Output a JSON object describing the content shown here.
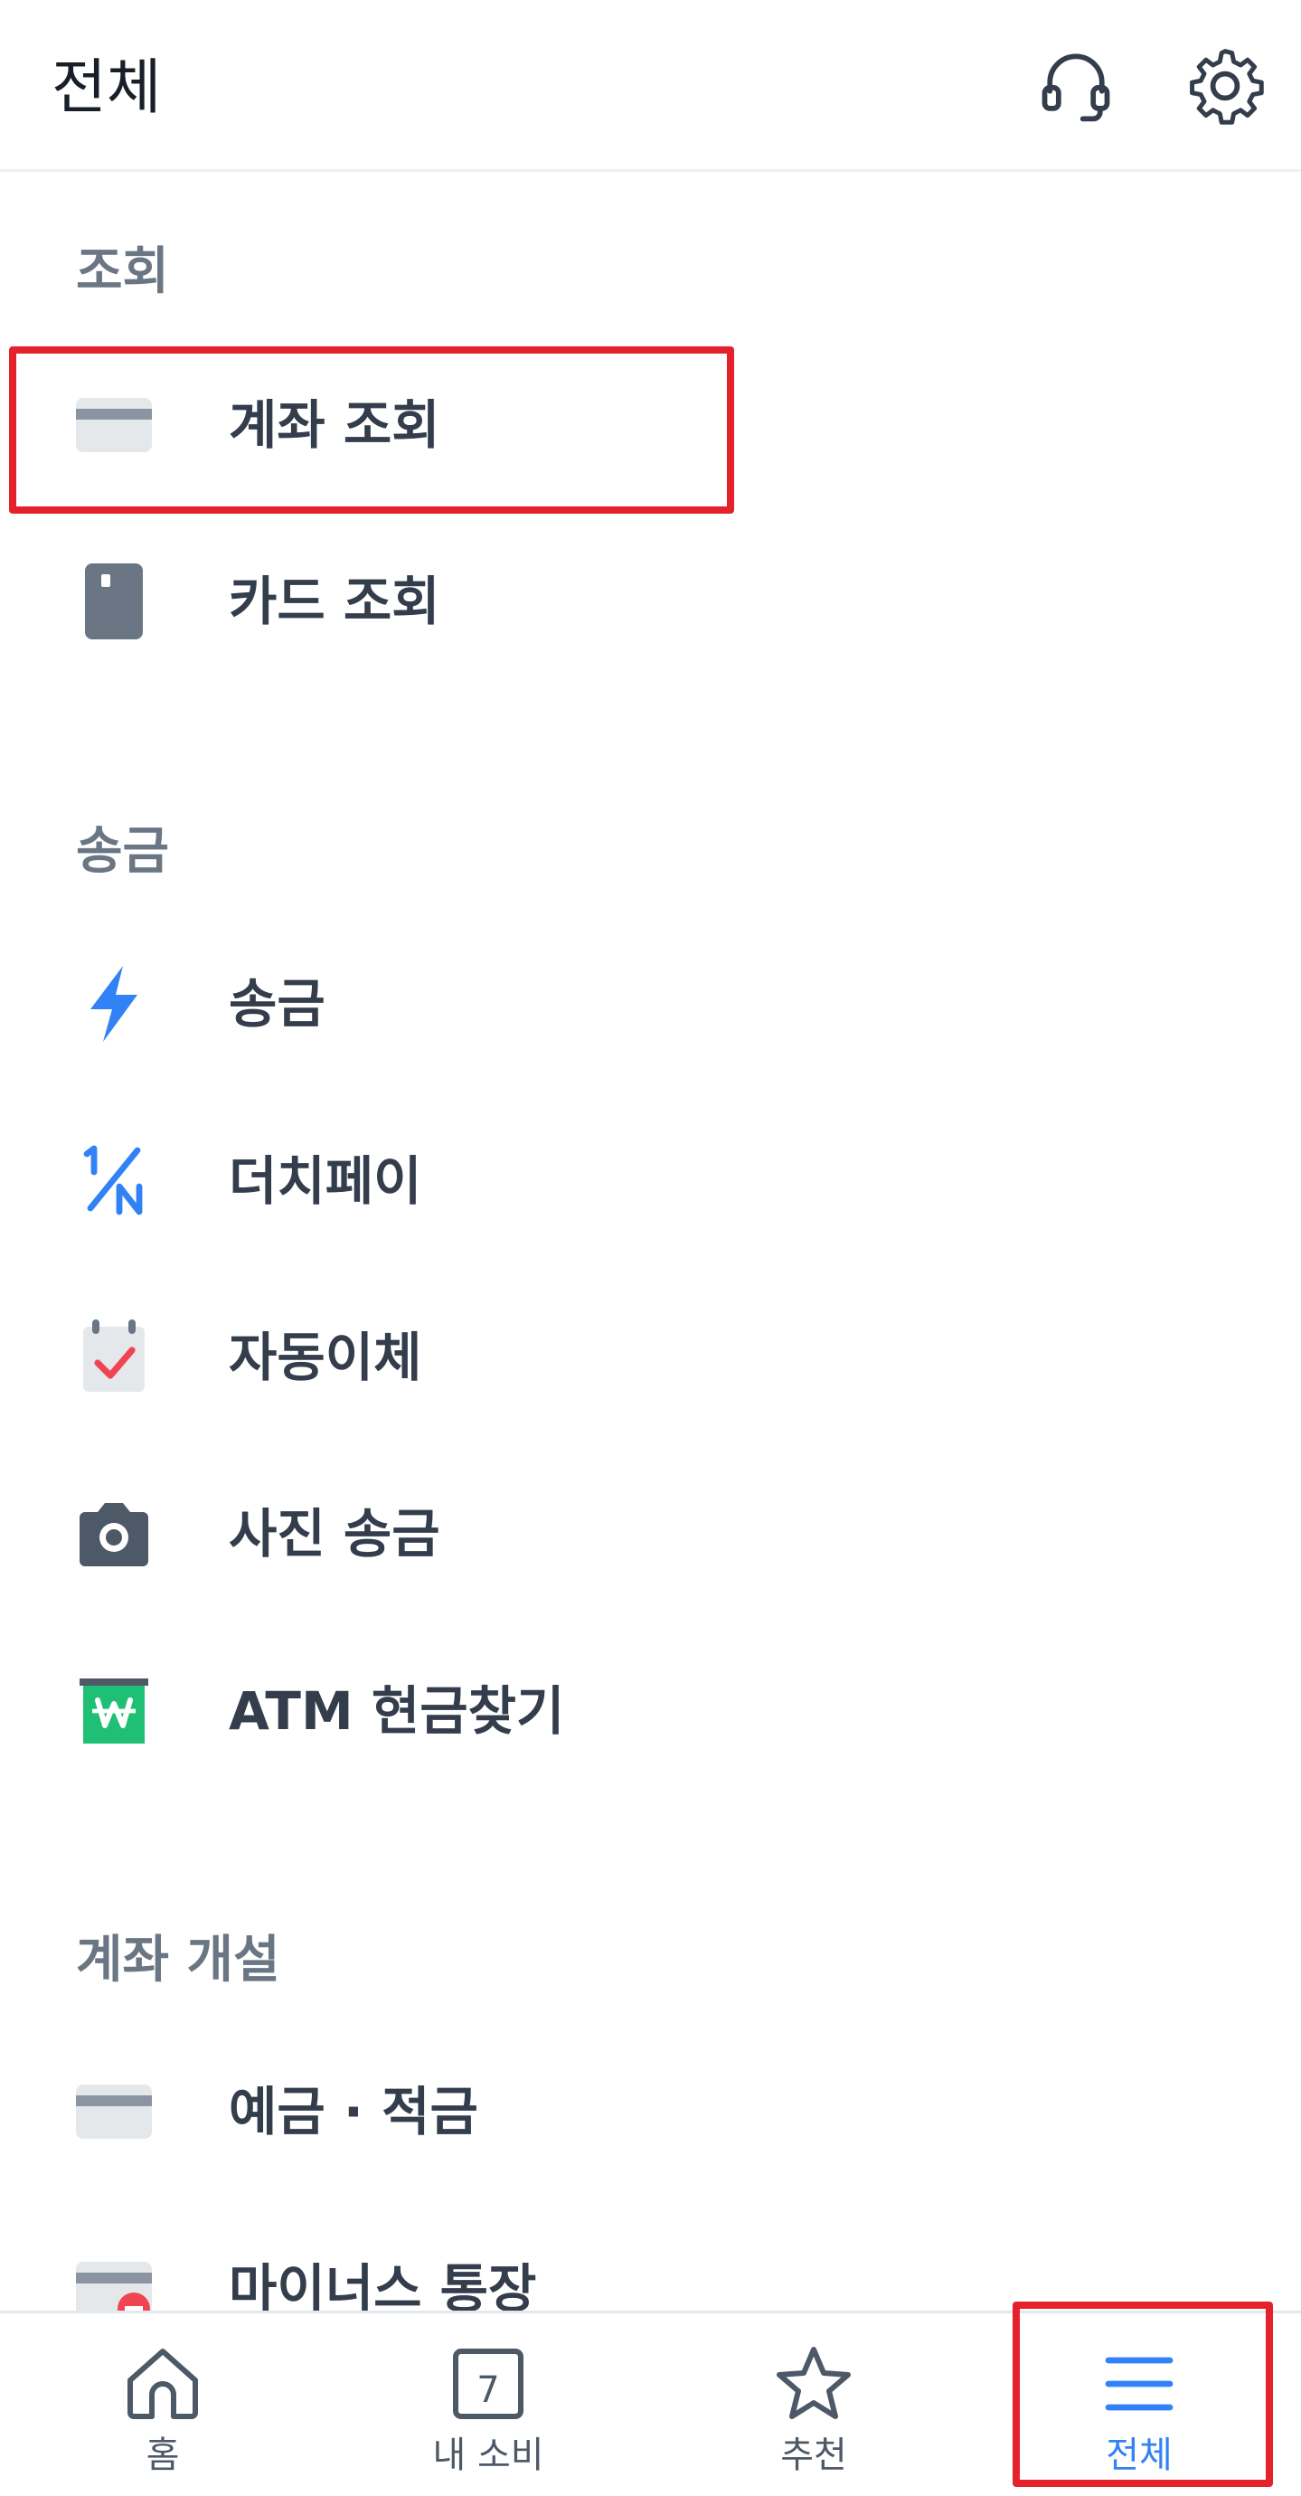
{
  "header": {
    "title": "전체",
    "support_icon": "headset-icon",
    "settings_icon": "gear-icon"
  },
  "sections": [
    {
      "title": "조회",
      "items": [
        {
          "label": "계좌 조회",
          "icon": "account-card-icon"
        },
        {
          "label": "카드 조회",
          "icon": "card-icon"
        }
      ]
    },
    {
      "title": "송금",
      "items": [
        {
          "label": "송금",
          "icon": "lightning-icon"
        },
        {
          "label": "더치페이",
          "icon": "one-over-n-icon"
        },
        {
          "label": "자동이체",
          "icon": "calendar-check-icon"
        },
        {
          "label": "사진 송금",
          "icon": "camera-icon"
        },
        {
          "label": "ATM 현금찾기",
          "icon": "atm-won-icon"
        }
      ]
    },
    {
      "title": "계좌 개설",
      "items": [
        {
          "label": "예금 · 적금",
          "icon": "savings-card-icon"
        },
        {
          "label": "마이너스 통장",
          "icon": "minus-account-icon"
        }
      ]
    }
  ],
  "tabbar": {
    "tabs": [
      {
        "label": "홈",
        "icon": "home-icon",
        "active": false
      },
      {
        "label": "내 소비",
        "icon": "calendar-7-icon",
        "calendar_number": "7",
        "active": false
      },
      {
        "label": "추천",
        "icon": "star-icon",
        "active": false
      },
      {
        "label": "전체",
        "icon": "menu-icon",
        "active": true
      }
    ]
  },
  "colors": {
    "accent": "#3182f6",
    "highlight_box": "#e5212b",
    "section_title": "#6b7684",
    "item_text": "#333d4b",
    "atm_green": "#1fbf75",
    "check_red": "#f04452"
  }
}
